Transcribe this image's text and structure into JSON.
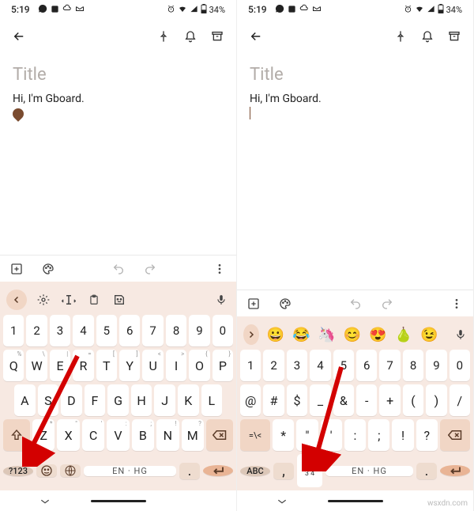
{
  "status": {
    "time": "5:19",
    "battery": "34%"
  },
  "note": {
    "title_placeholder": "Title",
    "body": "Hi, I'm Gboard."
  },
  "keyboard_left": {
    "mode_key": "?123",
    "space_label": "EN · HG",
    "num_row": [
      "1",
      "2",
      "3",
      "4",
      "5",
      "6",
      "7",
      "8",
      "9",
      "0"
    ],
    "row1": [
      "Q",
      "W",
      "E",
      "R",
      "T",
      "Y",
      "U",
      "I",
      "O",
      "P"
    ],
    "row2": [
      "A",
      "S",
      "D",
      "F",
      "G",
      "H",
      "J",
      "K",
      "L"
    ],
    "row3": [
      "Z",
      "X",
      "C",
      "V",
      "B",
      "N",
      "M"
    ],
    "hints1": [
      "%",
      "\\",
      "|",
      "=",
      "[",
      "]",
      "<",
      ">",
      "{",
      "}"
    ],
    "hints3": [
      "*",
      "\"",
      "'",
      ":",
      ";",
      "!",
      "?"
    ]
  },
  "keyboard_right": {
    "mode_key": "ABC",
    "space_label": "EN · HG",
    "num_row": [
      "1",
      "2",
      "3",
      "4",
      "5",
      "6",
      "7",
      "8",
      "9",
      "0"
    ],
    "row1": [
      "@",
      "#",
      "$",
      "_",
      "&",
      "-",
      "+",
      "(",
      ")",
      "/"
    ],
    "row2_lead": "=\\<",
    "row2": [
      "*",
      "\"",
      "'",
      ":",
      ";",
      "!",
      "?"
    ],
    "numpad_key": "1 2\n3 4",
    "emojis": [
      "😀",
      "😂",
      "🦄",
      "😊",
      "😍",
      "🍐",
      "😉"
    ]
  },
  "watermark": "wsxdn.com"
}
